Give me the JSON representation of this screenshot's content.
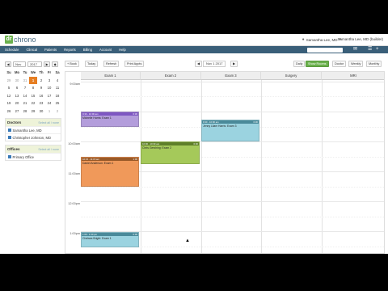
{
  "app": {
    "logo_badge": "dr",
    "logo_text": "chrono",
    "user_name": "Samantha Lee, MD",
    "provider_name": "Samantha Lee, MD (builder)"
  },
  "nav": {
    "items": [
      "Schedule",
      "Clinical",
      "Patients",
      "Reports",
      "Billing",
      "Account",
      "Help"
    ]
  },
  "mini_calendar": {
    "prev": "◀",
    "next": "▶",
    "today_btn": "◆",
    "month": "Nov",
    "year": "2017",
    "weekdays": [
      "Su",
      "Mo",
      "Tu",
      "We",
      "Th",
      "Fr",
      "Sa"
    ],
    "weeks": [
      [
        "29",
        "30",
        "31",
        "1",
        "2",
        "3",
        "4"
      ],
      [
        "5",
        "6",
        "7",
        "8",
        "9",
        "10",
        "11"
      ],
      [
        "12",
        "13",
        "14",
        "15",
        "16",
        "17",
        "18"
      ],
      [
        "19",
        "20",
        "21",
        "22",
        "23",
        "24",
        "25"
      ],
      [
        "26",
        "27",
        "28",
        "29",
        "30",
        "1",
        "2"
      ]
    ],
    "today": "1"
  },
  "doctors_panel": {
    "title": "Doctors",
    "links": "Select all / none",
    "items": [
      "Samantha Lee, MD",
      "Christopher Johnson, MD"
    ]
  },
  "offices_panel": {
    "title": "Offices",
    "links": "Select all / none",
    "items": [
      "Primary Office"
    ]
  },
  "toolbar": {
    "book": "+ Book",
    "today": "Today",
    "refresh": "Refresh",
    "print": "Print Appts",
    "prev": "◀",
    "date": "Nov 1 2017",
    "next": "▶",
    "views": [
      "Daily",
      "Show Rooms",
      "Doctor",
      "Weekly",
      "Monthly"
    ]
  },
  "columns": [
    "Exam 1",
    "Exam 2",
    "Exam 3",
    "Surgery",
    "MRI"
  ],
  "times": [
    "9:00am",
    "10:00am",
    "11:00am",
    "12:00pm",
    "1:00pm"
  ],
  "appointments": [
    {
      "header": "9:30 - 10:00 am",
      "badge": "0:30",
      "patient": "Michelle Harris: Exam 1",
      "color": "#b39ddb",
      "bar": "#7e57c2"
    },
    {
      "header": "9:30 - 10:00 am",
      "badge": "0:30",
      "patient": "Jenny Lilam Harris: Exam 3",
      "color": "#9bd3e0",
      "bar": "#4a8a9a"
    },
    {
      "header": "10:00 - 10:30 am",
      "badge": "0:30",
      "patient": "Chris Gershing: Exam 2",
      "color": "#a5c95a",
      "bar": "#5f7f2a"
    },
    {
      "header": "10:15 - 11:15 am",
      "badge": "1:00",
      "patient": "Daniel Anderson: Exam 1",
      "color": "#f0995a",
      "bar": "#9a5a28"
    },
    {
      "header": "1:00 - 1:30 pm",
      "badge": "0:30",
      "patient": "Chelsea Bright: Exam 1",
      "color": "#9bd3e0",
      "bar": "#4a8a9a"
    }
  ]
}
